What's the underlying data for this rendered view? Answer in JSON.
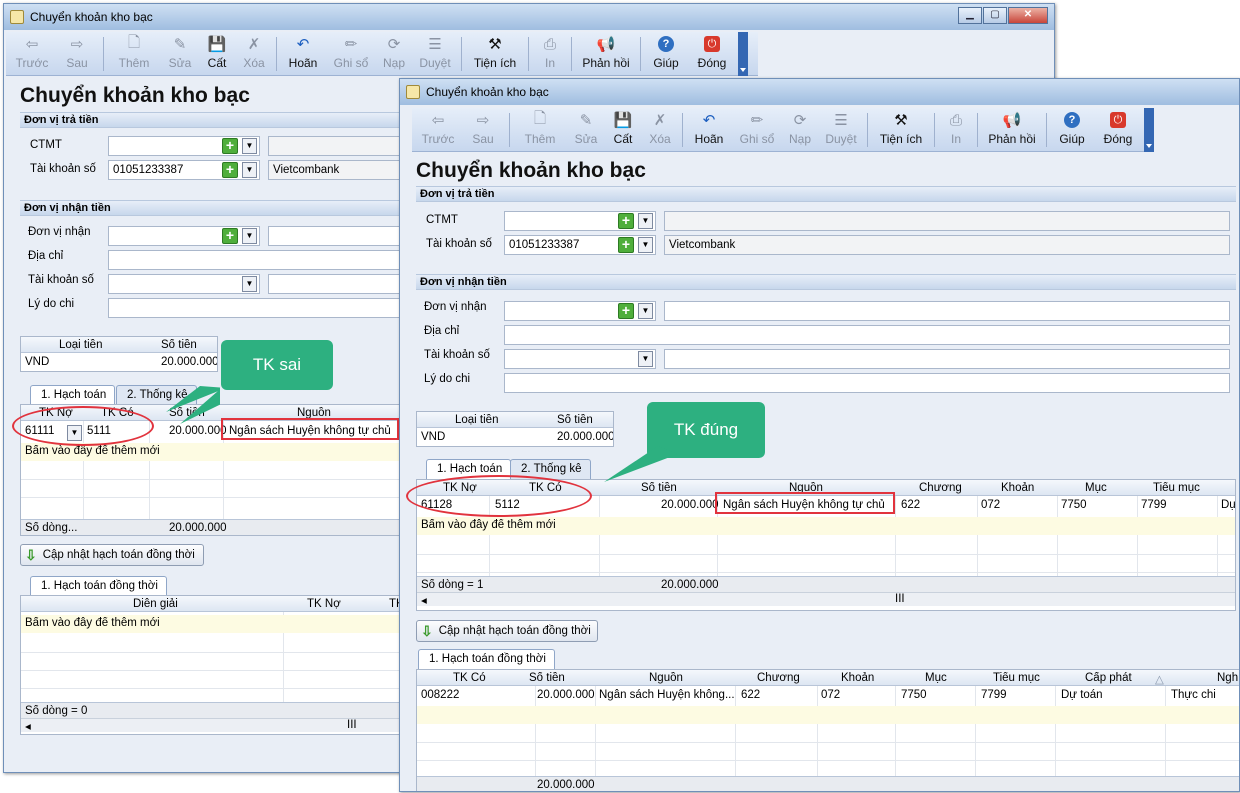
{
  "window_title": "Chuyển khoản kho bạc",
  "toolbar": [
    {
      "label": "Trước",
      "icon": "arrow-left-icon",
      "enabled": false
    },
    {
      "label": "Sau",
      "icon": "arrow-right-icon",
      "enabled": false
    },
    {
      "label": "Thêm",
      "icon": "add-doc-icon",
      "enabled": false
    },
    {
      "label": "Sửa",
      "icon": "edit-doc-icon",
      "enabled": false
    },
    {
      "label": "Cất",
      "icon": "save-icon",
      "enabled": true
    },
    {
      "label": "Xóa",
      "icon": "delete-doc-icon",
      "enabled": false
    },
    {
      "label": "Hoãn",
      "icon": "undo-icon",
      "enabled": true
    },
    {
      "label": "Ghi sổ",
      "icon": "pencil-icon",
      "enabled": false
    },
    {
      "label": "Nạp",
      "icon": "reload-icon",
      "enabled": false
    },
    {
      "label": "Duyệt",
      "icon": "approve-icon",
      "enabled": false
    },
    {
      "label": "Tiện ích",
      "icon": "tools-icon",
      "enabled": true
    },
    {
      "label": "In",
      "icon": "print-icon",
      "enabled": false
    },
    {
      "label": "Phản hồi",
      "icon": "megaphone-icon",
      "enabled": true
    },
    {
      "label": "Giúp",
      "icon": "help-icon",
      "enabled": true
    },
    {
      "label": "Đóng",
      "icon": "close-power-icon",
      "enabled": true
    }
  ],
  "page_title": "Chuyển khoản kho bạc",
  "payer": {
    "section": "Đơn vị trả tiền",
    "ctmt_label": "CTMT",
    "ctmt_value": "",
    "account_label": "Tài khoản số",
    "account_value": "01051233387",
    "bank_name": "Vietcombank"
  },
  "payee": {
    "section": "Đơn vị nhận tiền",
    "unit_label": "Đơn vị nhận",
    "address_label": "Địa chỉ",
    "account_label": "Tài khoản số",
    "reason_label": "Lý do chi"
  },
  "currency": {
    "col_type": "Loại tiền",
    "col_amount": "Số tiền",
    "type": "VND",
    "amount": "20.000.000"
  },
  "tabs": {
    "tab1": "1. Hạch toán",
    "tab2": "2. Thống kê",
    "tab3": "1. Hạch toán đồng thời"
  },
  "accounting_grid_back": {
    "headers": [
      "TK Nợ",
      "TK Có",
      "Số tiền",
      "Nguồn"
    ],
    "row": {
      "debit": "61111",
      "credit": "5111",
      "amount": "20.000.000",
      "source": "Ngân sách Huyện không tự chủ"
    },
    "add_hint": "Bấm vào đây để thêm mới",
    "footer_count": "Số dòng...",
    "footer_total": "20.000.000"
  },
  "accounting_grid_front": {
    "headers": [
      "TK Nợ",
      "TK Có",
      "Số tiền",
      "Nguồn",
      "Chương",
      "Khoản",
      "Mục",
      "Tiểu mục"
    ],
    "row": {
      "debit": "61128",
      "credit": "5112",
      "amount": "20.000.000",
      "source": "Ngân sách Huyện không tự chủ",
      "chapter": "622",
      "item": "072",
      "category": "7750",
      "subcategory": "7799",
      "extra": "Dự"
    },
    "add_hint": "Bấm vào đây để thêm mới",
    "footer_count": "Số dòng = 1",
    "footer_total": "20.000.000"
  },
  "update_button": "Cập nhật hạch toán đồng thời",
  "concurrent_grid_back": {
    "headers": [
      "Diễn giải",
      "TK Nợ",
      "TK"
    ],
    "add_hint": "Bấm vào đây để thêm mới",
    "footer_count": "Số dòng = 0"
  },
  "concurrent_grid_front": {
    "headers": [
      "TK Có",
      "Số tiền",
      "Nguồn",
      "Chương",
      "Khoản",
      "Mục",
      "Tiểu mục",
      "Cấp phát",
      "Ngh"
    ],
    "row": {
      "credit": "008222",
      "amount": "20.000.000",
      "source": "Ngân sách Huyện không...",
      "chapter": "622",
      "item": "072",
      "category": "7750",
      "subcategory": "7799",
      "allocation": "Dự toán",
      "type": "Thực chi"
    },
    "footer_total": "20.000.000"
  },
  "scroll_label": "III",
  "callouts": {
    "wrong": "TK sai",
    "right": "TK đúng"
  },
  "colors": {
    "callout": "#2db080",
    "highlight": "#e1333d",
    "accent": "#3467b3"
  }
}
